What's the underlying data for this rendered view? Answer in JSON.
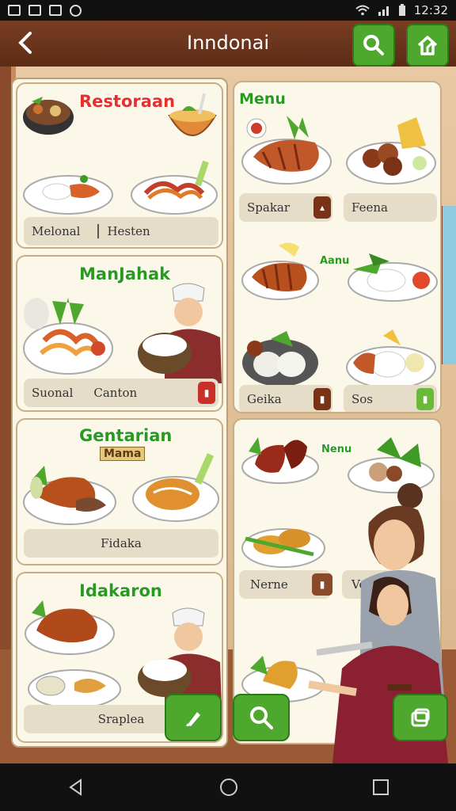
{
  "status": {
    "time": "12:32"
  },
  "header": {
    "title": "Inndonai"
  },
  "left_cards": [
    {
      "title": "Restoraan",
      "labels": [
        "Melonal",
        "Hesten"
      ]
    },
    {
      "title": "ManJahak",
      "labels": [
        "Suonal",
        "Canton"
      ]
    },
    {
      "title": "Gentarian",
      "subtitle": "Mama",
      "labels": [
        "Fidaka"
      ]
    },
    {
      "title": "Idakaron",
      "labels": [
        "Sraplea"
      ]
    }
  ],
  "right_panel": {
    "title": "Menu",
    "row1_labels": [
      "Spakar",
      "Feena"
    ],
    "small_label": "Aanu",
    "row3_labels": [
      "Geika",
      "Sos"
    ]
  },
  "right_panel2": {
    "title": "Nenu",
    "labels": [
      "Nerne",
      "Ve"
    ]
  },
  "colors": {
    "accent_green": "#4fa82e",
    "title_red": "#e8302a",
    "title_green": "#2a9a1e",
    "header_brown": "#6b3420"
  }
}
